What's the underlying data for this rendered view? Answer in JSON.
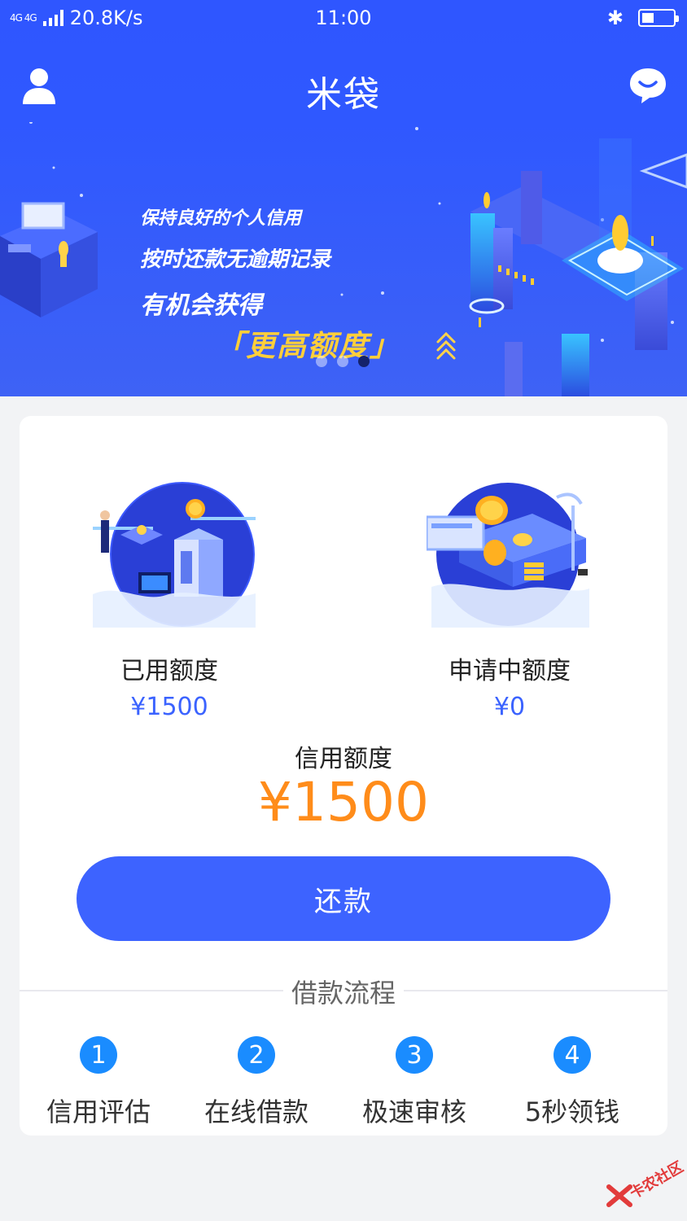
{
  "status_bar": {
    "network": "4G 4G",
    "speed": "20.8K/s",
    "time": "11:00",
    "bluetooth_icon": "bluetooth-icon",
    "battery_icon": "battery-icon"
  },
  "app_bar": {
    "title": "米袋",
    "left_icon": "user-icon",
    "right_icon": "message-icon"
  },
  "banner": {
    "line1": "保持良好的个人信用",
    "line2": "按时还款无逾期记录",
    "line3": "有机会获得",
    "line4": "「更高额度」",
    "slides": 3,
    "active_slide": 3
  },
  "card": {
    "used": {
      "label": "已用额度",
      "value": "¥1500"
    },
    "applying": {
      "label": "申请中额度",
      "value": "¥0"
    },
    "credit": {
      "label": "信用额度",
      "value": "¥1500"
    },
    "repay_button": "还款",
    "process_title": "借款流程",
    "steps": [
      {
        "num": "1",
        "label": "信用评估"
      },
      {
        "num": "2",
        "label": "在线借款"
      },
      {
        "num": "3",
        "label": "极速审核"
      },
      {
        "num": "4",
        "label": "5秒领钱"
      }
    ]
  },
  "watermark": "卡农社区",
  "colors": {
    "primary": "#3d63ff",
    "accent_orange": "#ff8c1a",
    "step_blue": "#1a8cff",
    "banner_gold": "#ffcf3a"
  }
}
